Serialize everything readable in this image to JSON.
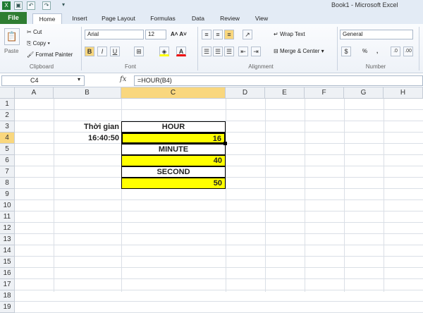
{
  "window": {
    "title": "Book1 - Microsoft Excel"
  },
  "tabs": [
    "File",
    "Home",
    "Insert",
    "Page Layout",
    "Formulas",
    "Data",
    "Review",
    "View"
  ],
  "clipboard": {
    "paste": "Paste",
    "cut": "Cut",
    "copy": "Copy",
    "format_painter": "Format Painter",
    "group": "Clipboard"
  },
  "font": {
    "name": "Arial",
    "size": "12",
    "bold": "B",
    "italic": "I",
    "underline": "U",
    "group": "Font"
  },
  "alignment": {
    "wrap_text": "Wrap Text",
    "merge_center": "Merge & Center",
    "group": "Alignment"
  },
  "number": {
    "format": "General",
    "percent": "%",
    "comma": ",",
    "group": "Number"
  },
  "formula_bar": {
    "name_box": "C4",
    "fx": "fx",
    "formula": "=HOUR(B4)"
  },
  "columns": [
    "A",
    "B",
    "C",
    "D",
    "E",
    "F",
    "G",
    "H"
  ],
  "rows": [
    "1",
    "2",
    "3",
    "4",
    "5",
    "6",
    "7",
    "8",
    "9",
    "10",
    "11",
    "12",
    "13",
    "14",
    "15",
    "16",
    "17",
    "18",
    "19"
  ],
  "cells": {
    "b3": "Thời gian",
    "b4": "16:40:50",
    "c3": "HOUR",
    "c4": "16",
    "c5": "MINUTE",
    "c6": "40",
    "c7": "SECOND",
    "c8": "50"
  },
  "colors": {
    "highlight": "#ffff00",
    "file_tab": "#2e7d32",
    "selected_header": "#f9d77e"
  }
}
